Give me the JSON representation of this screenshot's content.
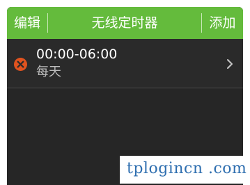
{
  "header": {
    "edit_label": "编辑",
    "title": "无线定时器",
    "add_label": "添加"
  },
  "timers": [
    {
      "time_range": "00:00-06:00",
      "repeat": "每天",
      "delete_icon": "delete-circle-icon",
      "nav_icon": "chevron-right-icon"
    }
  ],
  "watermark": "tplogincn .com",
  "colors": {
    "header_bg": "#64bb3c",
    "screen_bg": "#262626",
    "delete_icon": "#e0531f"
  }
}
